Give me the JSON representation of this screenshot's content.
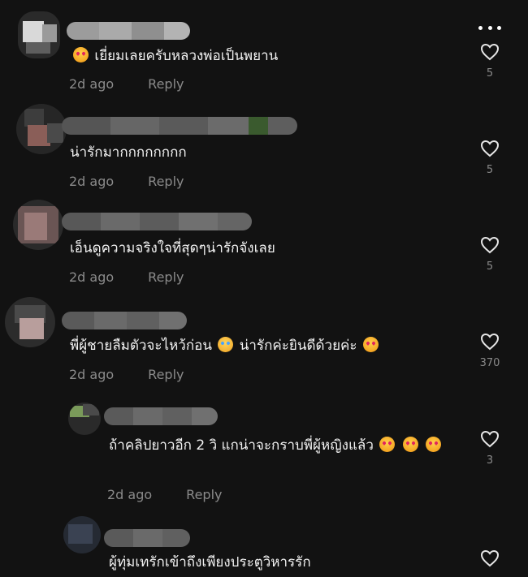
{
  "comments": [
    {
      "text": "เยี่ยมเลยครับหลวงพ่อเป็นพยาน",
      "time": "2d ago",
      "reply": "Reply",
      "likes": "5"
    },
    {
      "text": "น่ารักมากกกกกกกก",
      "time": "2d ago",
      "reply": "Reply",
      "likes": "5"
    },
    {
      "text": "เอ็นดูความจริงใจที่สุดๆน่ารักจังเลย",
      "time": "2d ago",
      "reply": "Reply",
      "likes": "5"
    },
    {
      "text_a": "พี่ผู้ชายลืมตัวจะไหว้ก่อน",
      "text_b": "น่ารักค่ะยินดีด้วยค่ะ",
      "time": "2d ago",
      "reply": "Reply",
      "likes": "370"
    },
    {
      "text": "ถ้าคลิปยาวอีก 2 วิ แกน่าจะกราบพี่ผู้หญิงแล้ว",
      "time": "2d ago",
      "reply": "Reply",
      "likes": "3"
    },
    {
      "text": "ผู้ทุ่มเทรักเข้าถึงเพียงประตูวิหารรัก"
    }
  ]
}
